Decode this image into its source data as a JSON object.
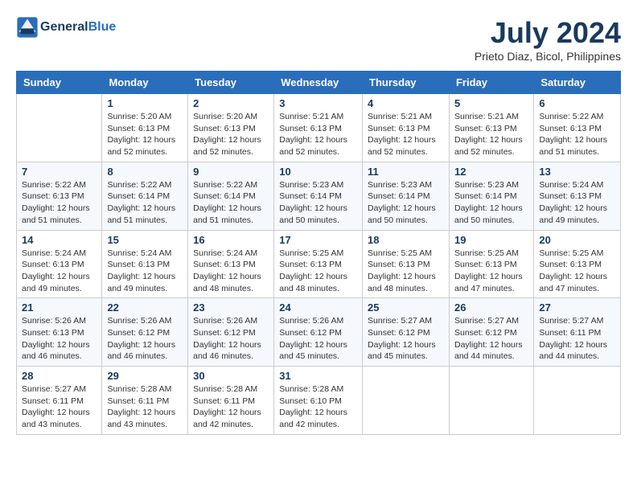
{
  "header": {
    "logo_line1": "General",
    "logo_line2": "Blue",
    "month_year": "July 2024",
    "location": "Prieto Diaz, Bicol, Philippines"
  },
  "weekdays": [
    "Sunday",
    "Monday",
    "Tuesday",
    "Wednesday",
    "Thursday",
    "Friday",
    "Saturday"
  ],
  "weeks": [
    [
      {
        "day": "",
        "text": ""
      },
      {
        "day": "1",
        "text": "Sunrise: 5:20 AM\nSunset: 6:13 PM\nDaylight: 12 hours\nand 52 minutes."
      },
      {
        "day": "2",
        "text": "Sunrise: 5:20 AM\nSunset: 6:13 PM\nDaylight: 12 hours\nand 52 minutes."
      },
      {
        "day": "3",
        "text": "Sunrise: 5:21 AM\nSunset: 6:13 PM\nDaylight: 12 hours\nand 52 minutes."
      },
      {
        "day": "4",
        "text": "Sunrise: 5:21 AM\nSunset: 6:13 PM\nDaylight: 12 hours\nand 52 minutes."
      },
      {
        "day": "5",
        "text": "Sunrise: 5:21 AM\nSunset: 6:13 PM\nDaylight: 12 hours\nand 52 minutes."
      },
      {
        "day": "6",
        "text": "Sunrise: 5:22 AM\nSunset: 6:13 PM\nDaylight: 12 hours\nand 51 minutes."
      }
    ],
    [
      {
        "day": "7",
        "text": "Sunrise: 5:22 AM\nSunset: 6:13 PM\nDaylight: 12 hours\nand 51 minutes."
      },
      {
        "day": "8",
        "text": "Sunrise: 5:22 AM\nSunset: 6:14 PM\nDaylight: 12 hours\nand 51 minutes."
      },
      {
        "day": "9",
        "text": "Sunrise: 5:22 AM\nSunset: 6:14 PM\nDaylight: 12 hours\nand 51 minutes."
      },
      {
        "day": "10",
        "text": "Sunrise: 5:23 AM\nSunset: 6:14 PM\nDaylight: 12 hours\nand 50 minutes."
      },
      {
        "day": "11",
        "text": "Sunrise: 5:23 AM\nSunset: 6:14 PM\nDaylight: 12 hours\nand 50 minutes."
      },
      {
        "day": "12",
        "text": "Sunrise: 5:23 AM\nSunset: 6:14 PM\nDaylight: 12 hours\nand 50 minutes."
      },
      {
        "day": "13",
        "text": "Sunrise: 5:24 AM\nSunset: 6:13 PM\nDaylight: 12 hours\nand 49 minutes."
      }
    ],
    [
      {
        "day": "14",
        "text": "Sunrise: 5:24 AM\nSunset: 6:13 PM\nDaylight: 12 hours\nand 49 minutes."
      },
      {
        "day": "15",
        "text": "Sunrise: 5:24 AM\nSunset: 6:13 PM\nDaylight: 12 hours\nand 49 minutes."
      },
      {
        "day": "16",
        "text": "Sunrise: 5:24 AM\nSunset: 6:13 PM\nDaylight: 12 hours\nand 48 minutes."
      },
      {
        "day": "17",
        "text": "Sunrise: 5:25 AM\nSunset: 6:13 PM\nDaylight: 12 hours\nand 48 minutes."
      },
      {
        "day": "18",
        "text": "Sunrise: 5:25 AM\nSunset: 6:13 PM\nDaylight: 12 hours\nand 48 minutes."
      },
      {
        "day": "19",
        "text": "Sunrise: 5:25 AM\nSunset: 6:13 PM\nDaylight: 12 hours\nand 47 minutes."
      },
      {
        "day": "20",
        "text": "Sunrise: 5:25 AM\nSunset: 6:13 PM\nDaylight: 12 hours\nand 47 minutes."
      }
    ],
    [
      {
        "day": "21",
        "text": "Sunrise: 5:26 AM\nSunset: 6:13 PM\nDaylight: 12 hours\nand 46 minutes."
      },
      {
        "day": "22",
        "text": "Sunrise: 5:26 AM\nSunset: 6:12 PM\nDaylight: 12 hours\nand 46 minutes."
      },
      {
        "day": "23",
        "text": "Sunrise: 5:26 AM\nSunset: 6:12 PM\nDaylight: 12 hours\nand 46 minutes."
      },
      {
        "day": "24",
        "text": "Sunrise: 5:26 AM\nSunset: 6:12 PM\nDaylight: 12 hours\nand 45 minutes."
      },
      {
        "day": "25",
        "text": "Sunrise: 5:27 AM\nSunset: 6:12 PM\nDaylight: 12 hours\nand 45 minutes."
      },
      {
        "day": "26",
        "text": "Sunrise: 5:27 AM\nSunset: 6:12 PM\nDaylight: 12 hours\nand 44 minutes."
      },
      {
        "day": "27",
        "text": "Sunrise: 5:27 AM\nSunset: 6:11 PM\nDaylight: 12 hours\nand 44 minutes."
      }
    ],
    [
      {
        "day": "28",
        "text": "Sunrise: 5:27 AM\nSunset: 6:11 PM\nDaylight: 12 hours\nand 43 minutes."
      },
      {
        "day": "29",
        "text": "Sunrise: 5:28 AM\nSunset: 6:11 PM\nDaylight: 12 hours\nand 43 minutes."
      },
      {
        "day": "30",
        "text": "Sunrise: 5:28 AM\nSunset: 6:11 PM\nDaylight: 12 hours\nand 42 minutes."
      },
      {
        "day": "31",
        "text": "Sunrise: 5:28 AM\nSunset: 6:10 PM\nDaylight: 12 hours\nand 42 minutes."
      },
      {
        "day": "",
        "text": ""
      },
      {
        "day": "",
        "text": ""
      },
      {
        "day": "",
        "text": ""
      }
    ]
  ]
}
